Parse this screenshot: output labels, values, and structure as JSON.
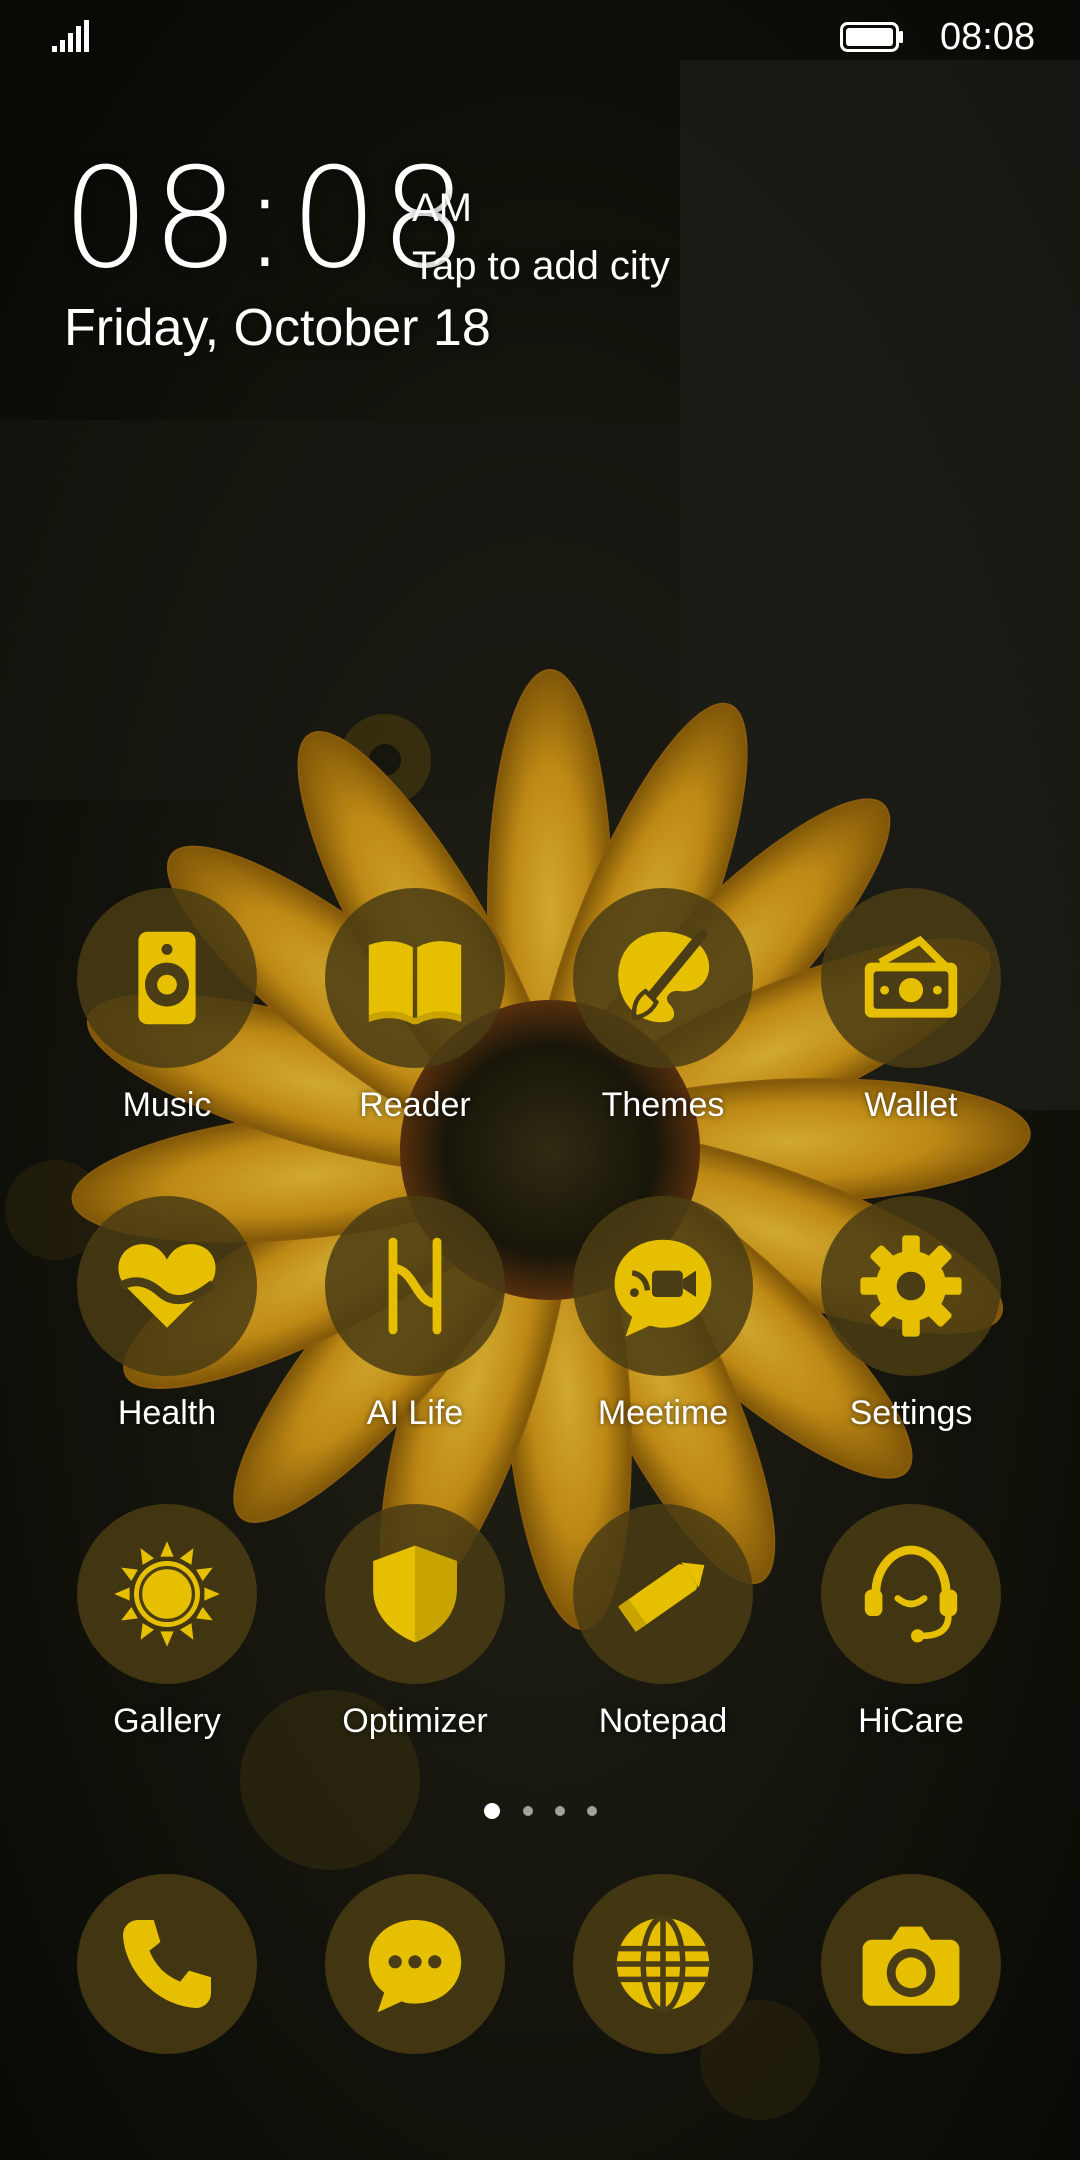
{
  "status_bar": {
    "time": "08:08",
    "signal_icon": "signal-icon",
    "battery_icon": "battery-icon"
  },
  "clock": {
    "time": "08:08",
    "ampm": "AM",
    "city_prompt": "Tap to add city",
    "date": "Friday, October 18"
  },
  "apps": [
    {
      "label": "Music",
      "icon": "music-speaker-icon"
    },
    {
      "label": "Reader",
      "icon": "book-icon"
    },
    {
      "label": "Themes",
      "icon": "paintbrush-icon"
    },
    {
      "label": "Wallet",
      "icon": "wallet-icon"
    },
    {
      "label": "Health",
      "icon": "heart-icon"
    },
    {
      "label": "AI Life",
      "icon": "ai-life-icon"
    },
    {
      "label": "Meetime",
      "icon": "video-chat-icon"
    },
    {
      "label": "Settings",
      "icon": "gear-icon"
    },
    {
      "label": "Gallery",
      "icon": "sun-icon"
    },
    {
      "label": "Optimizer",
      "icon": "shield-icon"
    },
    {
      "label": "Notepad",
      "icon": "pencil-icon"
    },
    {
      "label": "HiCare",
      "icon": "headset-icon"
    }
  ],
  "page_indicator": {
    "pages": 4,
    "current": 1
  },
  "dock": [
    {
      "icon": "phone-icon"
    },
    {
      "icon": "messages-icon"
    },
    {
      "icon": "browser-globe-icon"
    },
    {
      "icon": "camera-icon"
    }
  ],
  "colors": {
    "icon_yellow": "#e6c000",
    "bubble": "#4a3c14",
    "petal": "#e8a81a"
  }
}
